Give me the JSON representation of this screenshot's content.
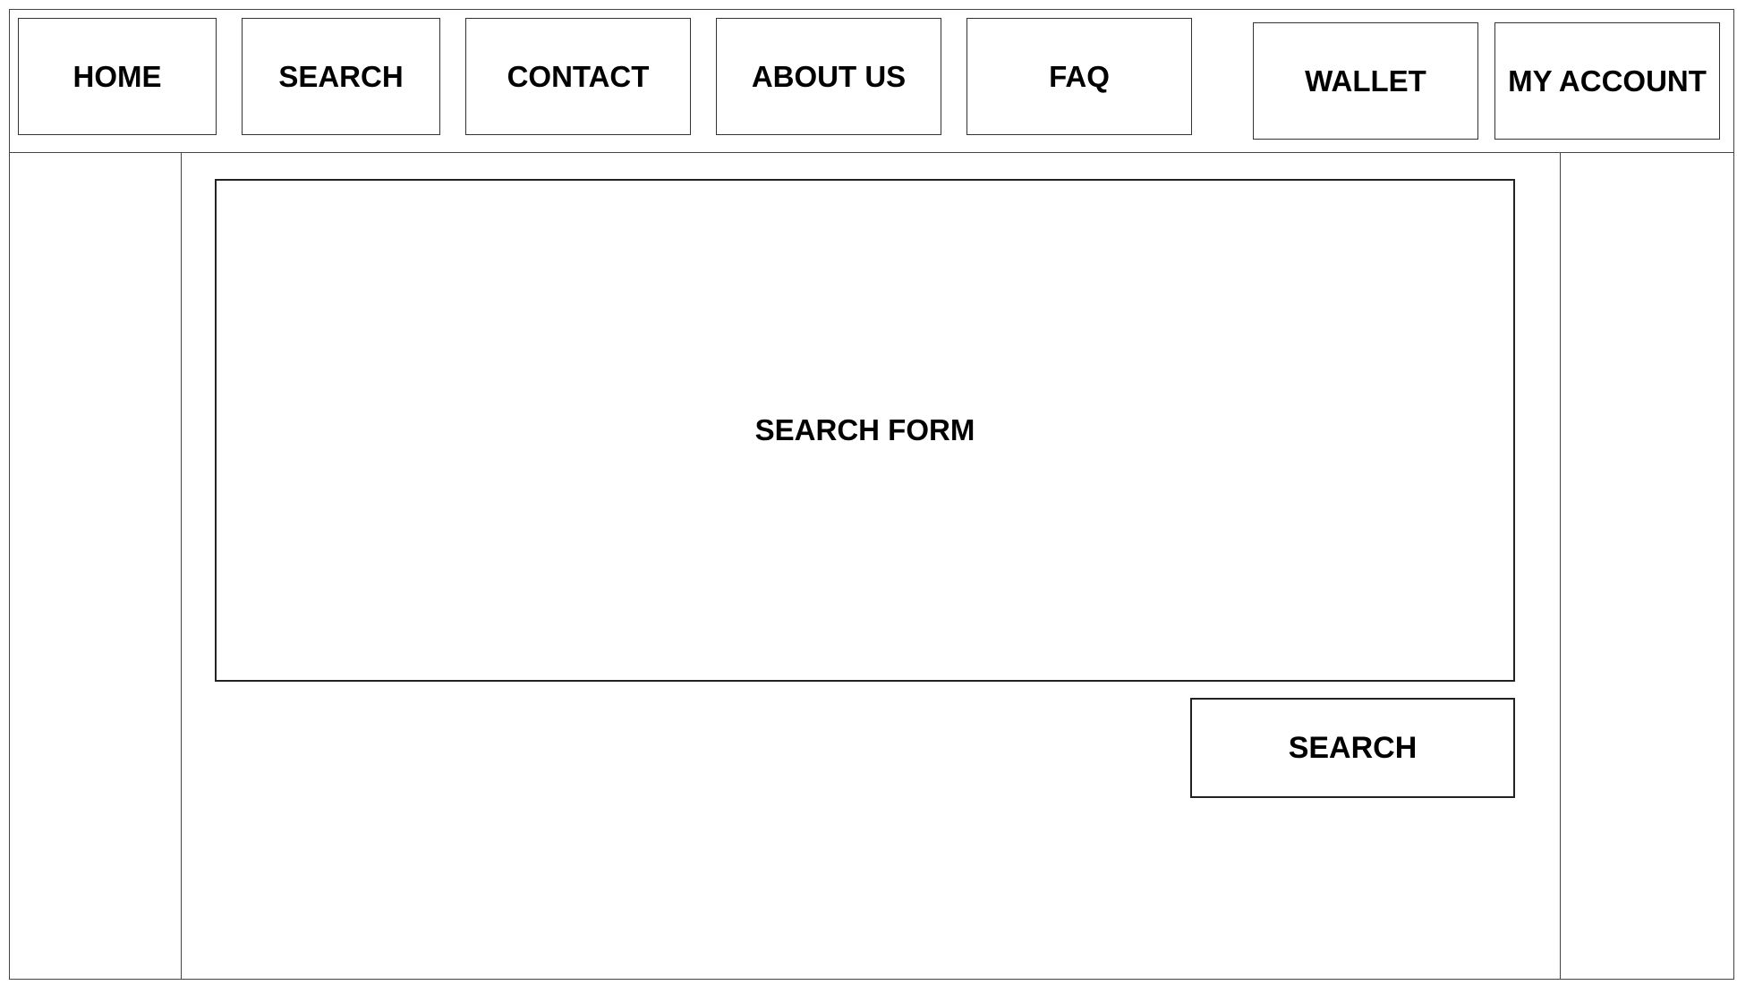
{
  "nav": {
    "home": "HOME",
    "search": "SEARCH",
    "contact": "CONTACT",
    "about": "ABOUT US",
    "faq": "FAQ"
  },
  "account_nav": {
    "wallet": "WALLET",
    "my_account": "MY ACCOUNT"
  },
  "main": {
    "search_form_label": "SEARCH FORM",
    "search_button_label": "SEARCH"
  },
  "colors": {
    "background": "#ffffff",
    "border": "#333333",
    "text": "#000000"
  }
}
